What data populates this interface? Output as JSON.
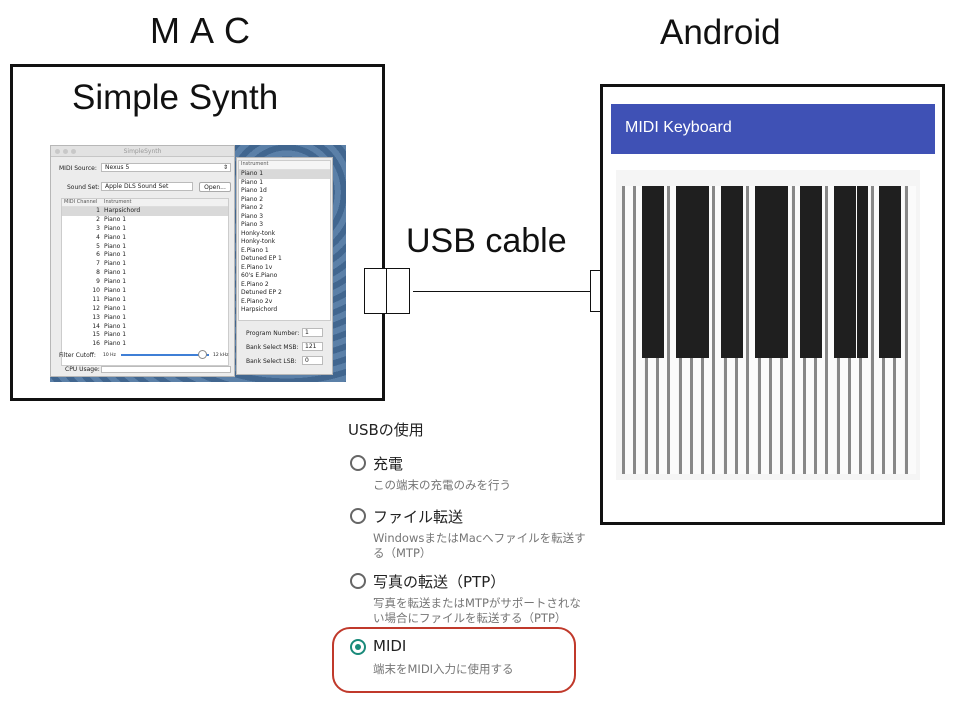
{
  "headings": {
    "mac": "M A C",
    "android": "Android"
  },
  "mac_box": {
    "title": "Simple Synth"
  },
  "simplesynth": {
    "window_title": "SimpleSynth",
    "midi_source_label": "MIDI Source:",
    "midi_source_value": "Nexus 5",
    "sound_set_label": "Sound Set:",
    "sound_set_value": "Apple DLS Sound Set",
    "open_button": "Open...",
    "col_channel": "MIDI Channel",
    "col_instrument": "Instrument",
    "channels": [
      {
        "num": "1",
        "inst": "Harpsichord"
      },
      {
        "num": "2",
        "inst": "Piano 1"
      },
      {
        "num": "3",
        "inst": "Piano 1"
      },
      {
        "num": "4",
        "inst": "Piano 1"
      },
      {
        "num": "5",
        "inst": "Piano 1"
      },
      {
        "num": "6",
        "inst": "Piano 1"
      },
      {
        "num": "7",
        "inst": "Piano 1"
      },
      {
        "num": "8",
        "inst": "Piano 1"
      },
      {
        "num": "9",
        "inst": "Piano 1"
      },
      {
        "num": "10",
        "inst": "Piano 1"
      },
      {
        "num": "11",
        "inst": "Piano 1"
      },
      {
        "num": "12",
        "inst": "Piano 1"
      },
      {
        "num": "13",
        "inst": "Piano 1"
      },
      {
        "num": "14",
        "inst": "Piano 1"
      },
      {
        "num": "15",
        "inst": "Piano 1"
      },
      {
        "num": "16",
        "inst": "Piano 1"
      }
    ],
    "filter_label": "Filter Cutoff:",
    "filter_min": "10 Hz",
    "filter_max": "12 kHz",
    "filter_level": 0.92,
    "cpu_label": "CPU Usage:",
    "instrument_header": "Instrument",
    "instruments": [
      "Piano 1",
      "Piano 1",
      "Piano 1d",
      "Piano 2",
      "Piano 2",
      "Piano 3",
      "Piano 3",
      "Honky-tonk",
      "Honky-tonk",
      "E.Piano 1",
      "Detuned EP 1",
      "E.Piano 1v",
      "60's E.Piano",
      "E.Piano 2",
      "Detuned EP 2",
      "E.Piano 2v",
      "Harpsichord"
    ],
    "program_number_label": "Program Number:",
    "program_number_value": "1",
    "bank_msb_label": "Bank Select MSB:",
    "bank_msb_value": "121",
    "bank_lsb_label": "Bank Select LSB:",
    "bank_lsb_value": "0"
  },
  "cable": {
    "label": "USB cable"
  },
  "android_app": {
    "title": "MIDI Keyboard"
  },
  "usb_settings": {
    "title": "USBの使用",
    "options": [
      {
        "label": "充電",
        "desc": "この端末の充電のみを行う",
        "selected": false
      },
      {
        "label": "ファイル転送",
        "desc": "WindowsまたはMacへファイルを転送す\nる（MTP）",
        "selected": false
      },
      {
        "label": "写真の転送（PTP）",
        "desc": "写真を転送またはMTPがサポートされな\nい場合にファイルを転送する（PTP）",
        "selected": false
      },
      {
        "label": "MIDI",
        "desc": "端末をMIDI入力に使用する",
        "selected": true
      }
    ],
    "accent_color": "#1a8a7a",
    "highlight_color": "#c0392b"
  },
  "colors": {
    "app_bar": "#3f51b5"
  }
}
